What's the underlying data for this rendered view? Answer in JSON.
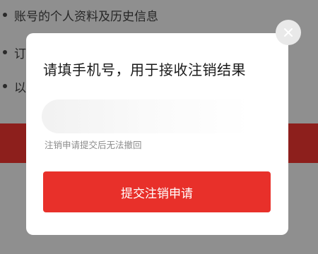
{
  "background": {
    "items": [
      {
        "text": "账号的个人资料及历史信息"
      },
      {
        "text": "订"
      },
      {
        "text": "以"
      }
    ]
  },
  "dialog": {
    "title": "请填手机号，用于接收注销结果",
    "phone_placeholder": "",
    "hint": "注销申请提交后无法撤回",
    "submit_label": "提交注销申请",
    "close_icon": "close-icon"
  },
  "colors": {
    "primary_red": "#e8302a",
    "overlay": "#8f8f8f",
    "hint_text": "#8c8c8c"
  }
}
